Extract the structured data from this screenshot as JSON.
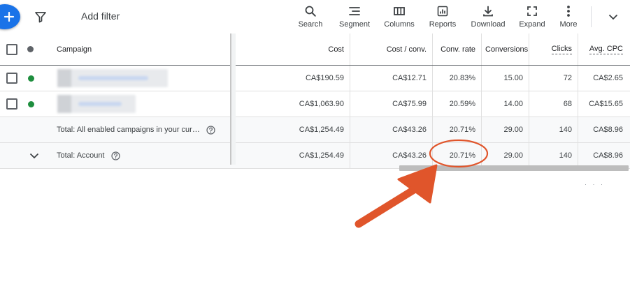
{
  "toolbar": {
    "add_filter": "Add filter",
    "tools": [
      {
        "label": "Search",
        "icon": "search-icon"
      },
      {
        "label": "Segment",
        "icon": "segment-icon"
      },
      {
        "label": "Columns",
        "icon": "columns-icon"
      },
      {
        "label": "Reports",
        "icon": "reports-icon"
      },
      {
        "label": "Download",
        "icon": "download-icon"
      },
      {
        "label": "Expand",
        "icon": "expand-icon"
      },
      {
        "label": "More",
        "icon": "more-vert-icon"
      }
    ]
  },
  "table": {
    "headers": {
      "campaign": "Campaign",
      "cost": "Cost",
      "cost_per_conv": "Cost / conv.",
      "conv_rate": "Conv. rate",
      "conversions": "Conversions",
      "clicks": "Clicks",
      "avg_cpc": "Avg. CPC"
    },
    "rows": [
      {
        "status_color": "#1e8e3e",
        "cost": "CA$190.59",
        "cost_per_conv": "CA$12.71",
        "conv_rate": "20.83%",
        "conversions": "15.00",
        "clicks": "72",
        "avg_cpc": "CA$2.65"
      },
      {
        "status_color": "#1e8e3e",
        "cost": "CA$1,063.90",
        "cost_per_conv": "CA$75.99",
        "conv_rate": "20.59%",
        "conversions": "14.00",
        "clicks": "68",
        "avg_cpc": "CA$15.65"
      }
    ],
    "totals": [
      {
        "label": "Total: All enabled campaigns in your cur…",
        "cost": "CA$1,254.49",
        "cost_per_conv": "CA$43.26",
        "conv_rate": "20.71%",
        "conversions": "29.00",
        "clicks": "140",
        "avg_cpc": "CA$8.96"
      },
      {
        "label": "Total: Account",
        "cost": "CA$1,254.49",
        "cost_per_conv": "CA$43.26",
        "conv_rate": "20.71%",
        "conversions": "29.00",
        "clicks": "140",
        "avg_cpc": "CA$8.96"
      }
    ]
  },
  "colors": {
    "accent": "#1a73e8",
    "annotation": "#e0552b",
    "status_enabled": "#1e8e3e",
    "status_header": "#5f6368"
  }
}
